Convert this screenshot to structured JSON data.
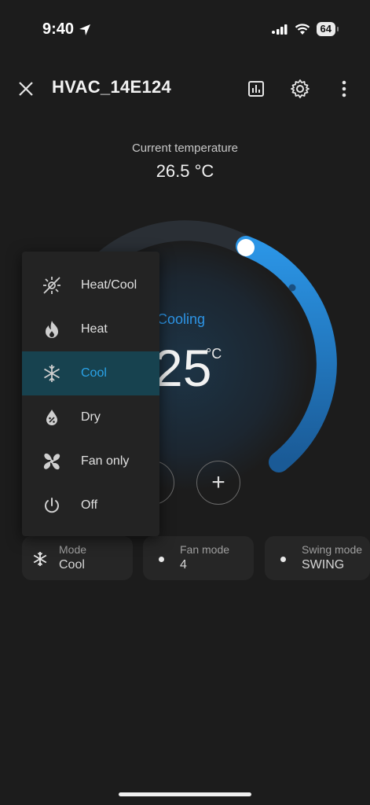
{
  "status_bar": {
    "time": "9:40",
    "battery": "64"
  },
  "header": {
    "title": "HVAC_14E124"
  },
  "current": {
    "label": "Current temperature",
    "value": "26.5 °C"
  },
  "thermostat": {
    "action": "Cooling",
    "target": "25",
    "unit": "°C",
    "minus": "−",
    "plus": "+"
  },
  "mode_menu": {
    "items": [
      {
        "label": "Heat/Cool",
        "icon": "heat-cool-icon"
      },
      {
        "label": "Heat",
        "icon": "flame-icon"
      },
      {
        "label": "Cool",
        "icon": "snowflake-icon",
        "selected": true
      },
      {
        "label": "Dry",
        "icon": "water-percent-icon"
      },
      {
        "label": "Fan only",
        "icon": "fan-icon"
      },
      {
        "label": "Off",
        "icon": "power-icon"
      }
    ]
  },
  "chips": [
    {
      "label": "Mode",
      "value": "Cool",
      "icon": "snowflake-icon"
    },
    {
      "label": "Fan mode",
      "value": "4",
      "icon": "dot-icon"
    },
    {
      "label": "Swing mode",
      "value": "SWING",
      "icon": "dot-icon"
    }
  ],
  "colors": {
    "accent": "#2d95e6",
    "selected_bg": "#17424f",
    "background": "#1c1c1c"
  }
}
